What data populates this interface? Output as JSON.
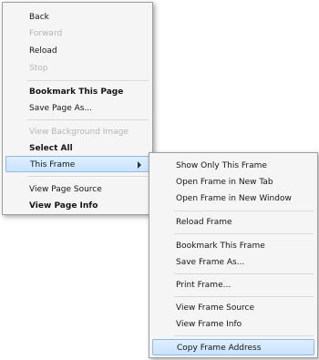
{
  "context_menu": {
    "items": [
      {
        "label": "Back",
        "enabled": true
      },
      {
        "label": "Forward",
        "enabled": false
      },
      {
        "label": "Reload",
        "enabled": true
      },
      {
        "label": "Stop",
        "enabled": false
      },
      {
        "label": "Bookmark This Page",
        "enabled": true
      },
      {
        "label": "Save Page As...",
        "enabled": true
      },
      {
        "label": "View Background Image",
        "enabled": false
      },
      {
        "label": "Select All",
        "enabled": true
      },
      {
        "label": "This Frame",
        "enabled": true,
        "has_submenu": true,
        "highlighted": true
      },
      {
        "label": "View Page Source",
        "enabled": true
      },
      {
        "label": "View Page Info",
        "enabled": true
      }
    ]
  },
  "frame_submenu": {
    "items": [
      {
        "label": "Show Only This Frame",
        "enabled": true
      },
      {
        "label": "Open Frame in New Tab",
        "enabled": true
      },
      {
        "label": "Open Frame in New Window",
        "enabled": true
      },
      {
        "label": "Reload Frame",
        "enabled": true
      },
      {
        "label": "Bookmark This Frame",
        "enabled": true
      },
      {
        "label": "Save Frame As...",
        "enabled": true
      },
      {
        "label": "Print Frame...",
        "enabled": true
      },
      {
        "label": "View Frame Source",
        "enabled": true
      },
      {
        "label": "View Frame Info",
        "enabled": true
      },
      {
        "label": "Copy Frame Address",
        "enabled": true,
        "highlighted": true
      }
    ]
  },
  "colors": {
    "menu_background": "#f5f5f5",
    "menu_border": "#9e9e9e",
    "highlight_background": "#cfe6ff",
    "highlight_border": "#8eb9ea",
    "text": "#151515",
    "disabled_text": "#b5b5b5"
  }
}
